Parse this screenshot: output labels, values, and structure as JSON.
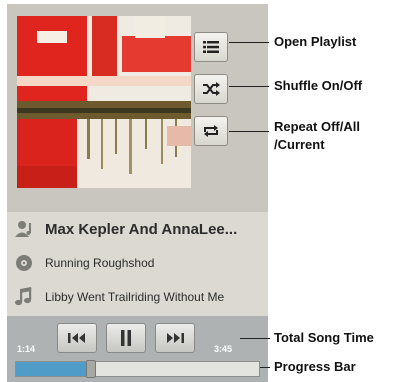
{
  "player": {
    "track": {
      "artist": "Max Kepler And AnnaLee...",
      "album": "Running Roughshod",
      "song": "Libby Went Trailriding Without  Me"
    },
    "time": {
      "elapsed": "1:14",
      "total": "3:45"
    },
    "progress_fraction": 0.29,
    "icons": {
      "playlist": "playlist-icon",
      "shuffle": "shuffle-icon",
      "repeat": "repeat-icon",
      "artist": "artist-icon",
      "album": "album-icon",
      "song": "song-icon",
      "previous": "previous-track-icon",
      "pause": "pause-icon",
      "next": "next-track-icon"
    },
    "colors": {
      "progress": "#4f9cc9",
      "panel": "#c9c6bd"
    }
  },
  "callouts": {
    "playlist": "Open Playlist",
    "shuffle": "Shuffle On/Off",
    "repeat_line1": "Repeat Off/All",
    "repeat_line2": "/Current",
    "total_time": "Total Song Time",
    "progress": "Progress Bar"
  }
}
